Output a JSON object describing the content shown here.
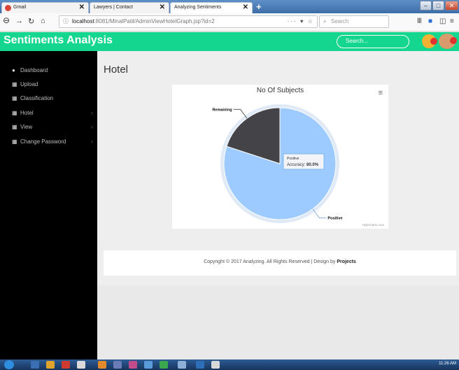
{
  "browser": {
    "tabs": [
      {
        "label": "Gmail",
        "color": "#d9453a"
      },
      {
        "label": "Lawyers | Contact",
        "color": "#999999"
      },
      {
        "label": "Analyzing Sentiments",
        "color": "#999999"
      }
    ],
    "url_host": "localhost",
    "url_rest": ":8081/MinalPatil/AdminViewHotelGraph.jsp?id=2",
    "search_placeholder": "Search"
  },
  "app": {
    "brand": "Sentiments Analysis",
    "search_placeholder": "Search...",
    "accent_color": "#14d68f"
  },
  "sidebar": {
    "items": [
      {
        "label": "Dashboard",
        "icon": "dashboard-icon",
        "glyph": "●",
        "has_children": false
      },
      {
        "label": "Upload",
        "icon": "table-icon",
        "glyph": "▦",
        "has_children": false
      },
      {
        "label": "Classification",
        "icon": "table-icon",
        "glyph": "▦",
        "has_children": false
      },
      {
        "label": "Hotel",
        "icon": "table-icon",
        "glyph": "▦",
        "has_children": true
      },
      {
        "label": "View",
        "icon": "table-icon",
        "glyph": "▦",
        "has_children": true
      },
      {
        "label": "Change Password",
        "icon": "table-icon",
        "glyph": "▦",
        "has_children": true
      }
    ]
  },
  "main": {
    "page_title": "Hotel",
    "footer_text": "Copyright © 2017 Analyzing. All Rights Reserved | Design by ",
    "footer_link": "Projects"
  },
  "chart_data": {
    "type": "pie",
    "title": "No Of Subjects",
    "slices": [
      {
        "label": "Positive",
        "value": 80.0,
        "color": "#9dcbff"
      },
      {
        "label": "Remaining",
        "value": 20.0,
        "color": "#434348"
      }
    ],
    "tooltip": {
      "series": "Positive",
      "label": "Accuracy:",
      "value": "80.0%"
    },
    "credits": "Highcharts.com"
  },
  "taskbar": {
    "clock": "11:26 AM"
  }
}
